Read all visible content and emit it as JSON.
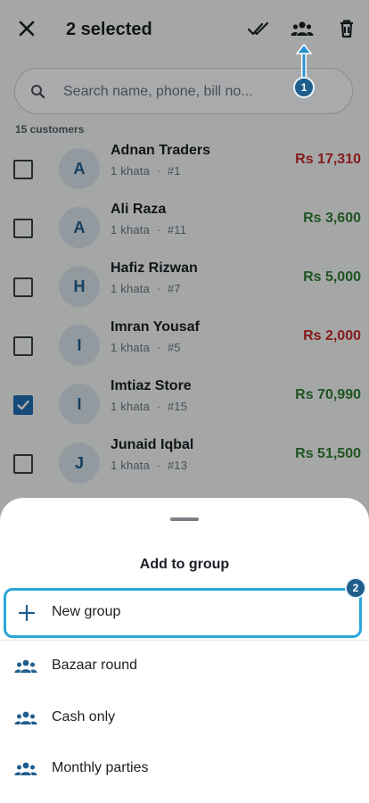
{
  "header": {
    "title": "2 selected",
    "close_icon": "close-icon",
    "actions": [
      "select-all-icon",
      "add-to-group-icon",
      "delete-icon"
    ]
  },
  "search": {
    "placeholder": "Search name, phone, bill no..."
  },
  "list": {
    "count_label": "15 customers",
    "customers": [
      {
        "initial": "A",
        "name": "Adnan Traders",
        "khata": "1 khata",
        "sep": "·",
        "id": "#1",
        "amount": "Rs 17,310",
        "status": "due",
        "checked": false
      },
      {
        "initial": "A",
        "name": "Ali Raza",
        "khata": "1 khata",
        "sep": "·",
        "id": "#11",
        "amount": "Rs 3,600",
        "status": "advance",
        "checked": false
      },
      {
        "initial": "H",
        "name": "Hafiz Rizwan",
        "khata": "1 khata",
        "sep": "·",
        "id": "#7",
        "amount": "Rs 5,000",
        "status": "advance",
        "checked": false
      },
      {
        "initial": "I",
        "name": "Imran Yousaf",
        "khata": "1 khata",
        "sep": "·",
        "id": "#5",
        "amount": "Rs 2,000",
        "status": "due",
        "checked": false
      },
      {
        "initial": "I",
        "name": "Imtiaz Store",
        "khata": "1 khata",
        "sep": "·",
        "id": "#15",
        "amount": "Rs 70,990",
        "status": "advance",
        "checked": true
      },
      {
        "initial": "J",
        "name": "Junaid Iqbal",
        "khata": "1 khata",
        "sep": "·",
        "id": "#13",
        "amount": "Rs 51,500",
        "status": "advance",
        "checked": false
      }
    ]
  },
  "sheet": {
    "title": "Add to group",
    "new_group": {
      "icon": "plus-icon",
      "label": "New group"
    },
    "groups": [
      {
        "icon": "group-icon",
        "label": "Bazaar round"
      },
      {
        "icon": "group-icon",
        "label": "Cash only"
      },
      {
        "icon": "group-icon",
        "label": "Monthly parties"
      }
    ]
  },
  "annotations": {
    "step1": "1",
    "step2": "2"
  },
  "colors": {
    "due": "#c62828",
    "advance": "#2e7d32",
    "accent": "#1f6fb3",
    "highlight": "#29a7d8",
    "badge": "#1f5d8c"
  }
}
